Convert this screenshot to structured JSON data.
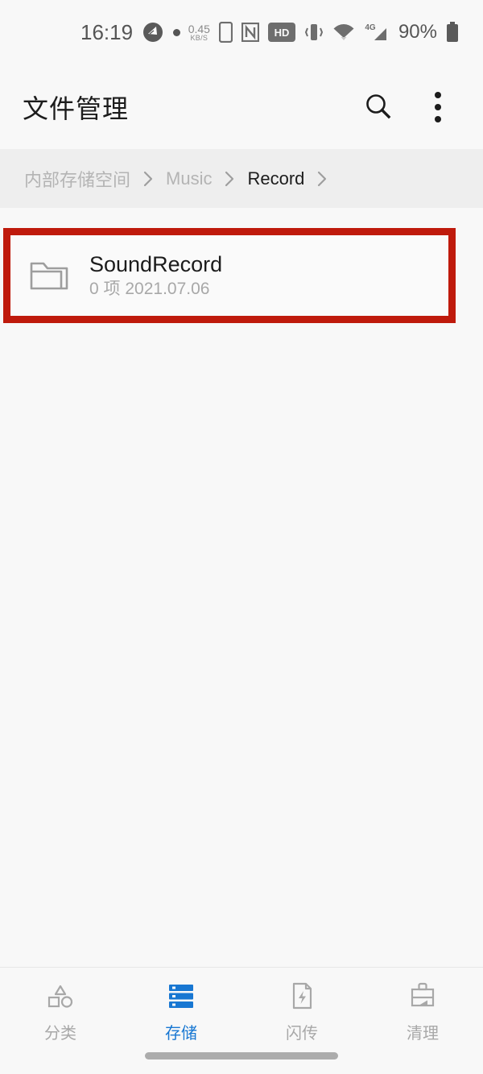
{
  "status_bar": {
    "time": "16:19",
    "net_speed_value": "0.45",
    "net_speed_unit": "KB/S",
    "battery_percent": "90%",
    "hd_label": "HD",
    "signal_label": "4G",
    "icons": [
      "notification-badge-icon",
      "dot-icon",
      "sim-card-icon",
      "nfc-icon",
      "hd-volte-icon",
      "vibrate-icon",
      "wifi-icon",
      "cellular-signal-icon",
      "battery-icon"
    ]
  },
  "app_bar": {
    "title": "文件管理",
    "search_icon": "search-icon",
    "overflow_icon": "overflow-menu-icon"
  },
  "breadcrumb": {
    "items": [
      {
        "label": "内部存储空间",
        "active": false
      },
      {
        "label": "Music",
        "active": false
      },
      {
        "label": "Record",
        "active": true
      }
    ],
    "separator": "chevron-right-icon",
    "trailing_separator": true
  },
  "file_list": {
    "highlight_color": "#bf1a0c",
    "items": [
      {
        "icon": "folder-icon",
        "name": "SoundRecord",
        "meta": "0 项  2021.07.06",
        "highlighted": true
      }
    ]
  },
  "bottom_nav": {
    "active_color": "#1877d2",
    "inactive_color": "#a8a8a8",
    "tabs": [
      {
        "label": "分类",
        "icon": "shapes-category-icon",
        "active": false
      },
      {
        "label": "存储",
        "icon": "storage-server-icon",
        "active": true
      },
      {
        "label": "闪传",
        "icon": "flash-transfer-icon",
        "active": false
      },
      {
        "label": "清理",
        "icon": "clean-broom-icon",
        "active": false
      }
    ],
    "gesture_bar": "home-gesture-bar"
  }
}
